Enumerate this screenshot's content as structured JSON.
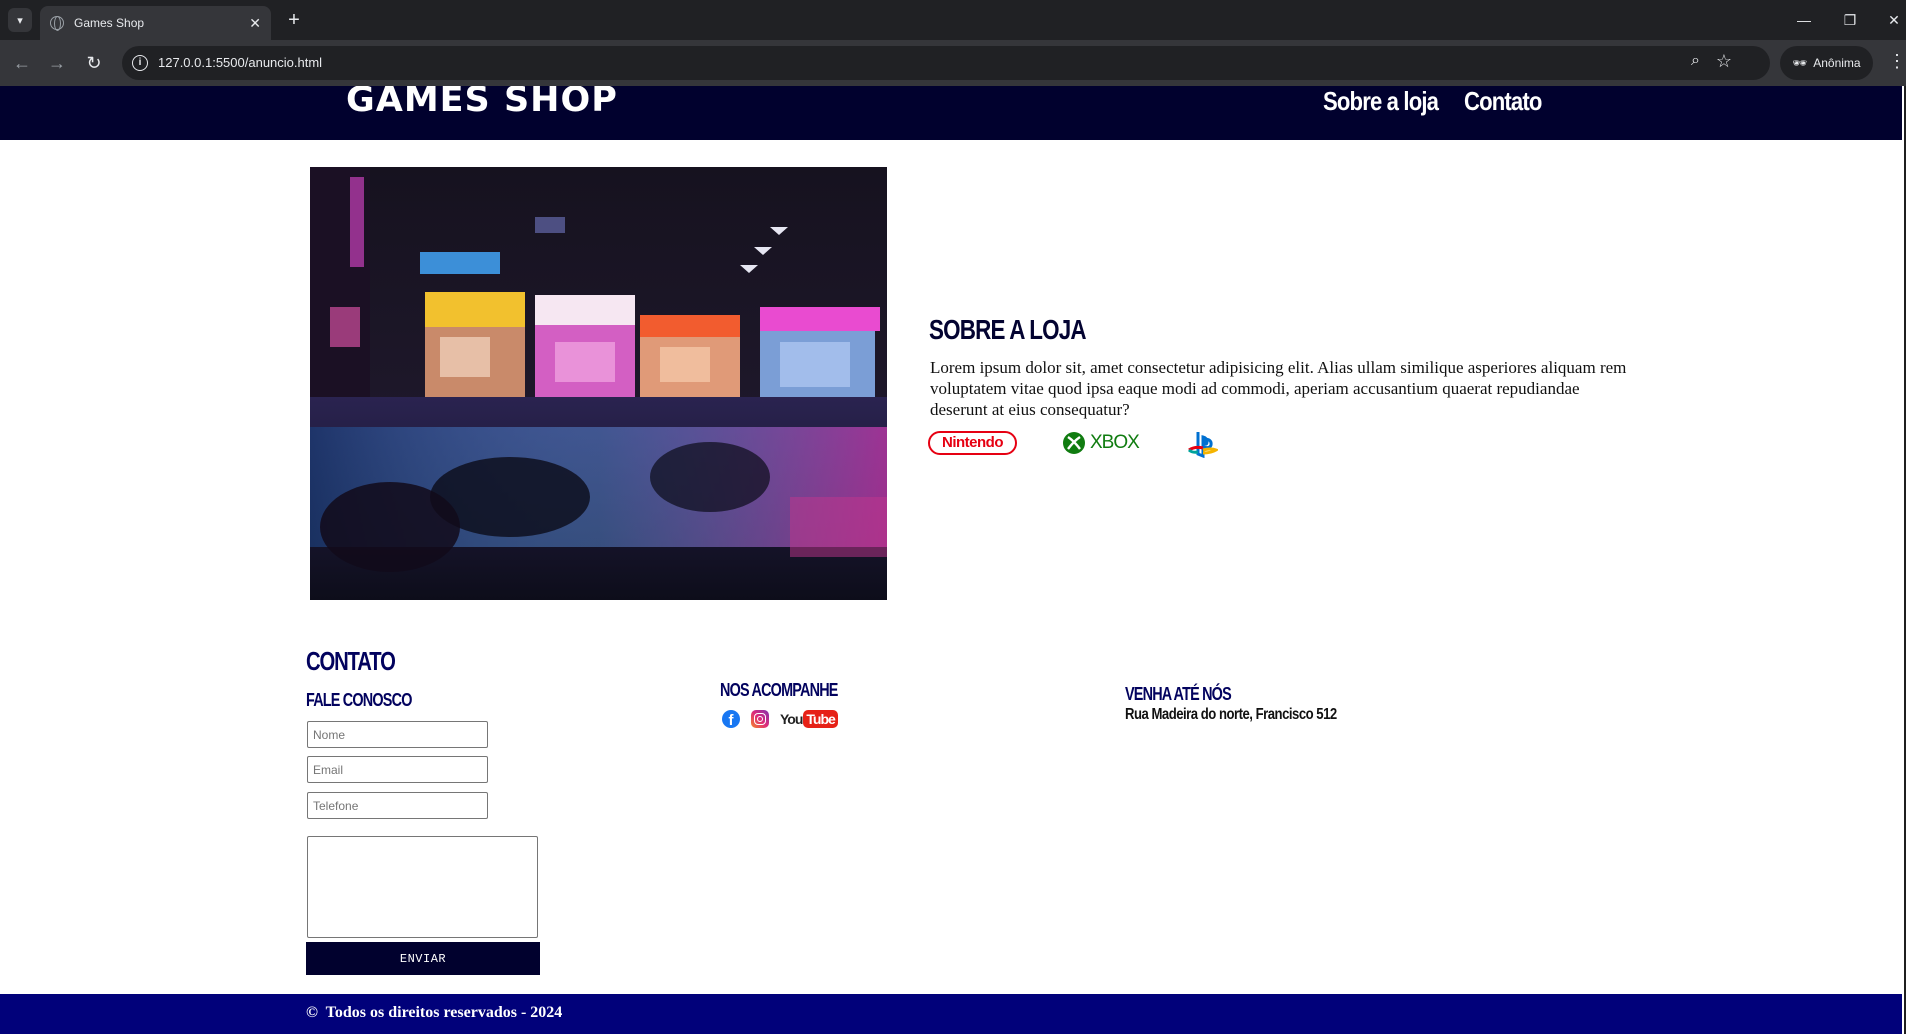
{
  "browser": {
    "tab_title": "Games Shop",
    "url": "127.0.0.1:5500/anuncio.html",
    "profile_label": "Anônima"
  },
  "header": {
    "brand": "GAMES SHOP",
    "nav": [
      {
        "label": "Sobre a loja"
      },
      {
        "label": "Contato"
      }
    ]
  },
  "about": {
    "title": "SOBRE A LOJA",
    "text": "Lorem ipsum dolor sit, amet consectetur adipisicing elit. Alias ullam similique asperiores aliquam rem voluptatem vitae quod ipsa eaque modi ad commodi, aperiam accusantium quaerat repudiandae deserunt at eius consequatur?",
    "brands": {
      "nintendo": "Nintendo",
      "xbox": "XBOX",
      "playstation_icon": "playstation-icon"
    }
  },
  "contact": {
    "title": "CONTATO",
    "form_title": "FALE CONOSCO",
    "placeholders": {
      "name": "Nome",
      "email": "Email",
      "phone": "Telefone"
    },
    "send_label": "ENVIAR",
    "social_title": "NOS ACOMPANHE",
    "social": {
      "youtube_you": "You",
      "youtube_tube": "Tube"
    },
    "visit_title": "VENHA ATÉ NÓS",
    "address": "Rua Madeira do norte, Francisco 512"
  },
  "footer": {
    "copyright_symbol": "©",
    "text": "Todos os direitos reservados - 2024"
  },
  "colors": {
    "header_bg": "#01012e",
    "footer_bg": "#01017a",
    "title_blue": "#02025e"
  }
}
